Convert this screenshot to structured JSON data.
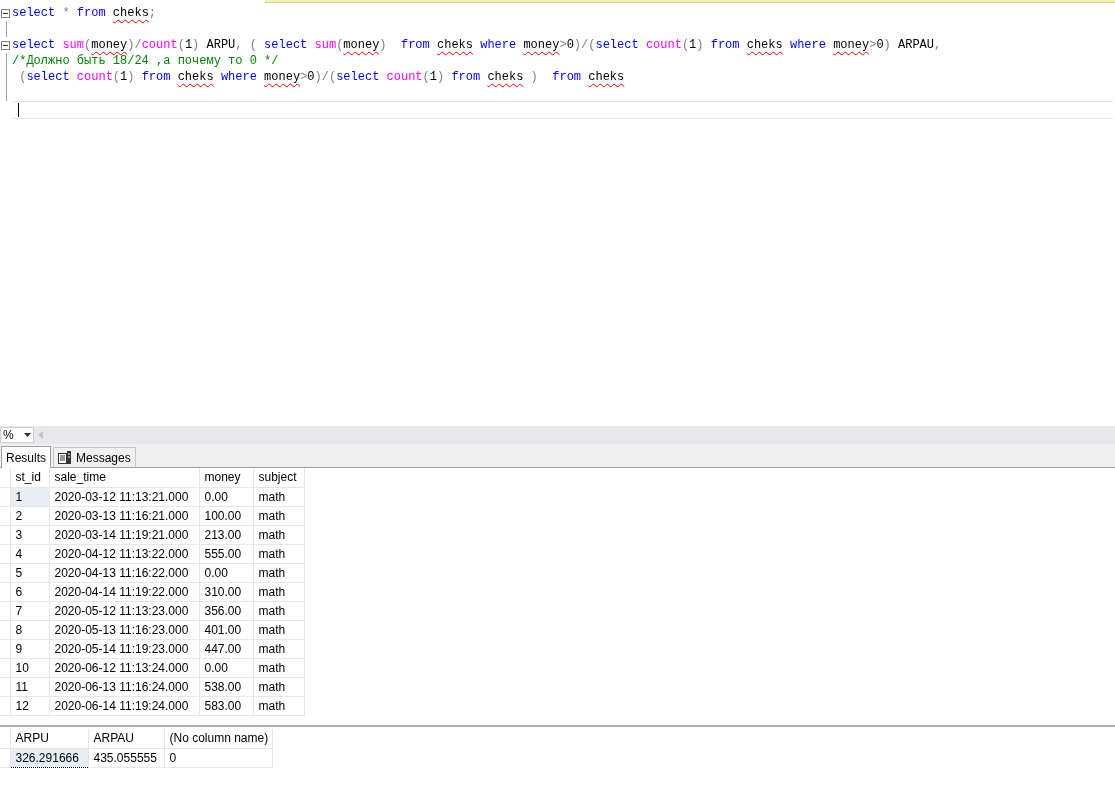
{
  "editor": {
    "lines": [
      {
        "fold": true,
        "tokens": [
          {
            "kind": "kw",
            "text": "select"
          },
          {
            "kind": "gray",
            "text": " * "
          },
          {
            "kind": "kw",
            "text": "from "
          },
          {
            "kind": "err",
            "text": "cheks"
          },
          {
            "kind": "gray",
            "text": ";"
          }
        ]
      },
      {
        "fold": false
      },
      {
        "fold": true,
        "tokens": [
          {
            "kind": "kw",
            "text": "select "
          },
          {
            "kind": "fn",
            "text": "sum"
          },
          {
            "kind": "gray",
            "text": "("
          },
          {
            "kind": "err",
            "text": "money"
          },
          {
            "kind": "gray",
            "text": ")/"
          },
          {
            "kind": "fn",
            "text": "count"
          },
          {
            "kind": "gray",
            "text": "("
          },
          {
            "kind": "plain",
            "text": "1"
          },
          {
            "kind": "gray",
            "text": ")"
          },
          {
            "kind": "plain",
            "text": " ARPU"
          },
          {
            "kind": "gray",
            "text": ", ( "
          },
          {
            "kind": "kw",
            "text": "select "
          },
          {
            "kind": "fn",
            "text": "sum"
          },
          {
            "kind": "gray",
            "text": "("
          },
          {
            "kind": "err",
            "text": "money"
          },
          {
            "kind": "gray",
            "text": ")  "
          },
          {
            "kind": "kw",
            "text": "from "
          },
          {
            "kind": "err",
            "text": "cheks"
          },
          {
            "kind": "kw",
            "text": " where "
          },
          {
            "kind": "err",
            "text": "money"
          },
          {
            "kind": "gray",
            "text": ">"
          },
          {
            "kind": "plain",
            "text": "0"
          },
          {
            "kind": "gray",
            "text": ")/("
          },
          {
            "kind": "kw",
            "text": "select "
          },
          {
            "kind": "fn",
            "text": "count"
          },
          {
            "kind": "gray",
            "text": "("
          },
          {
            "kind": "plain",
            "text": "1"
          },
          {
            "kind": "gray",
            "text": ") "
          },
          {
            "kind": "kw",
            "text": "from "
          },
          {
            "kind": "err",
            "text": "cheks"
          },
          {
            "kind": "kw",
            "text": " where "
          },
          {
            "kind": "err",
            "text": "money"
          },
          {
            "kind": "gray",
            "text": ">"
          },
          {
            "kind": "plain",
            "text": "0"
          },
          {
            "kind": "gray",
            "text": ")"
          },
          {
            "kind": "plain",
            "text": " ARPAU"
          },
          {
            "kind": "gray",
            "text": ","
          }
        ]
      },
      {
        "fold": false,
        "tokens": [
          {
            "kind": "comment",
            "text": "/*Должно быть 18/24 ,а почему то 0 */"
          }
        ]
      },
      {
        "fold": false,
        "tokens": [
          {
            "kind": "gray",
            "text": " ("
          },
          {
            "kind": "kw",
            "text": "select "
          },
          {
            "kind": "fn",
            "text": "count"
          },
          {
            "kind": "gray",
            "text": "("
          },
          {
            "kind": "plain",
            "text": "1"
          },
          {
            "kind": "gray",
            "text": ") "
          },
          {
            "kind": "kw",
            "text": "from "
          },
          {
            "kind": "err",
            "text": "cheks"
          },
          {
            "kind": "kw",
            "text": " where "
          },
          {
            "kind": "err",
            "text": "money"
          },
          {
            "kind": "gray",
            "text": ">"
          },
          {
            "kind": "plain",
            "text": "0"
          },
          {
            "kind": "gray",
            "text": ")/("
          },
          {
            "kind": "kw",
            "text": "select "
          },
          {
            "kind": "fn",
            "text": "count"
          },
          {
            "kind": "gray",
            "text": "("
          },
          {
            "kind": "plain",
            "text": "1"
          },
          {
            "kind": "gray",
            "text": ") "
          },
          {
            "kind": "kw",
            "text": "from "
          },
          {
            "kind": "err",
            "text": "cheks"
          },
          {
            "kind": "gray",
            "text": " )  "
          },
          {
            "kind": "kw",
            "text": "from "
          },
          {
            "kind": "err",
            "text": "cheks"
          }
        ]
      },
      {
        "fold": false
      }
    ]
  },
  "zoom": {
    "value": "%"
  },
  "tabs": [
    {
      "label": "Results",
      "selected": true
    },
    {
      "label": "Messages",
      "selected": false
    }
  ],
  "grids": [
    {
      "columns": [
        "st_id",
        "sale_time",
        "money",
        "subject"
      ],
      "rows": [
        {
          "selected": true,
          "cells": [
            "1",
            "2020-03-12 11:13:21.000",
            "0.00",
            "math"
          ]
        },
        {
          "selected": false,
          "cells": [
            "2",
            "2020-03-13 11:16:21.000",
            "100.00",
            "math"
          ]
        },
        {
          "selected": false,
          "cells": [
            "3",
            "2020-03-14 11:19:21.000",
            "213.00",
            "math"
          ]
        },
        {
          "selected": false,
          "cells": [
            "4",
            "2020-04-12 11:13:22.000",
            "555.00",
            "math"
          ]
        },
        {
          "selected": false,
          "cells": [
            "5",
            "2020-04-13 11:16:22.000",
            "0.00",
            "math"
          ]
        },
        {
          "selected": false,
          "cells": [
            "6",
            "2020-04-14 11:19:22.000",
            "310.00",
            "math"
          ]
        },
        {
          "selected": false,
          "cells": [
            "7",
            "2020-05-12 11:13:23.000",
            "356.00",
            "math"
          ]
        },
        {
          "selected": false,
          "cells": [
            "8",
            "2020-05-13 11:16:23.000",
            "401.00",
            "math"
          ]
        },
        {
          "selected": false,
          "cells": [
            "9",
            "2020-05-14 11:19:23.000",
            "447.00",
            "math"
          ]
        },
        {
          "selected": false,
          "cells": [
            "10",
            "2020-06-12 11:13:24.000",
            "0.00",
            "math"
          ]
        },
        {
          "selected": false,
          "cells": [
            "11",
            "2020-06-13 11:16:24.000",
            "538.00",
            "math"
          ]
        },
        {
          "selected": false,
          "cells": [
            "12",
            "2020-06-14 11:19:24.000",
            "583.00",
            "math"
          ]
        }
      ]
    },
    {
      "columns": [
        "ARPU",
        "ARPAU",
        "(No column name)"
      ],
      "rows": [
        {
          "selected": true,
          "cells": [
            "326.291666",
            "435.055555",
            "0"
          ]
        }
      ]
    }
  ]
}
